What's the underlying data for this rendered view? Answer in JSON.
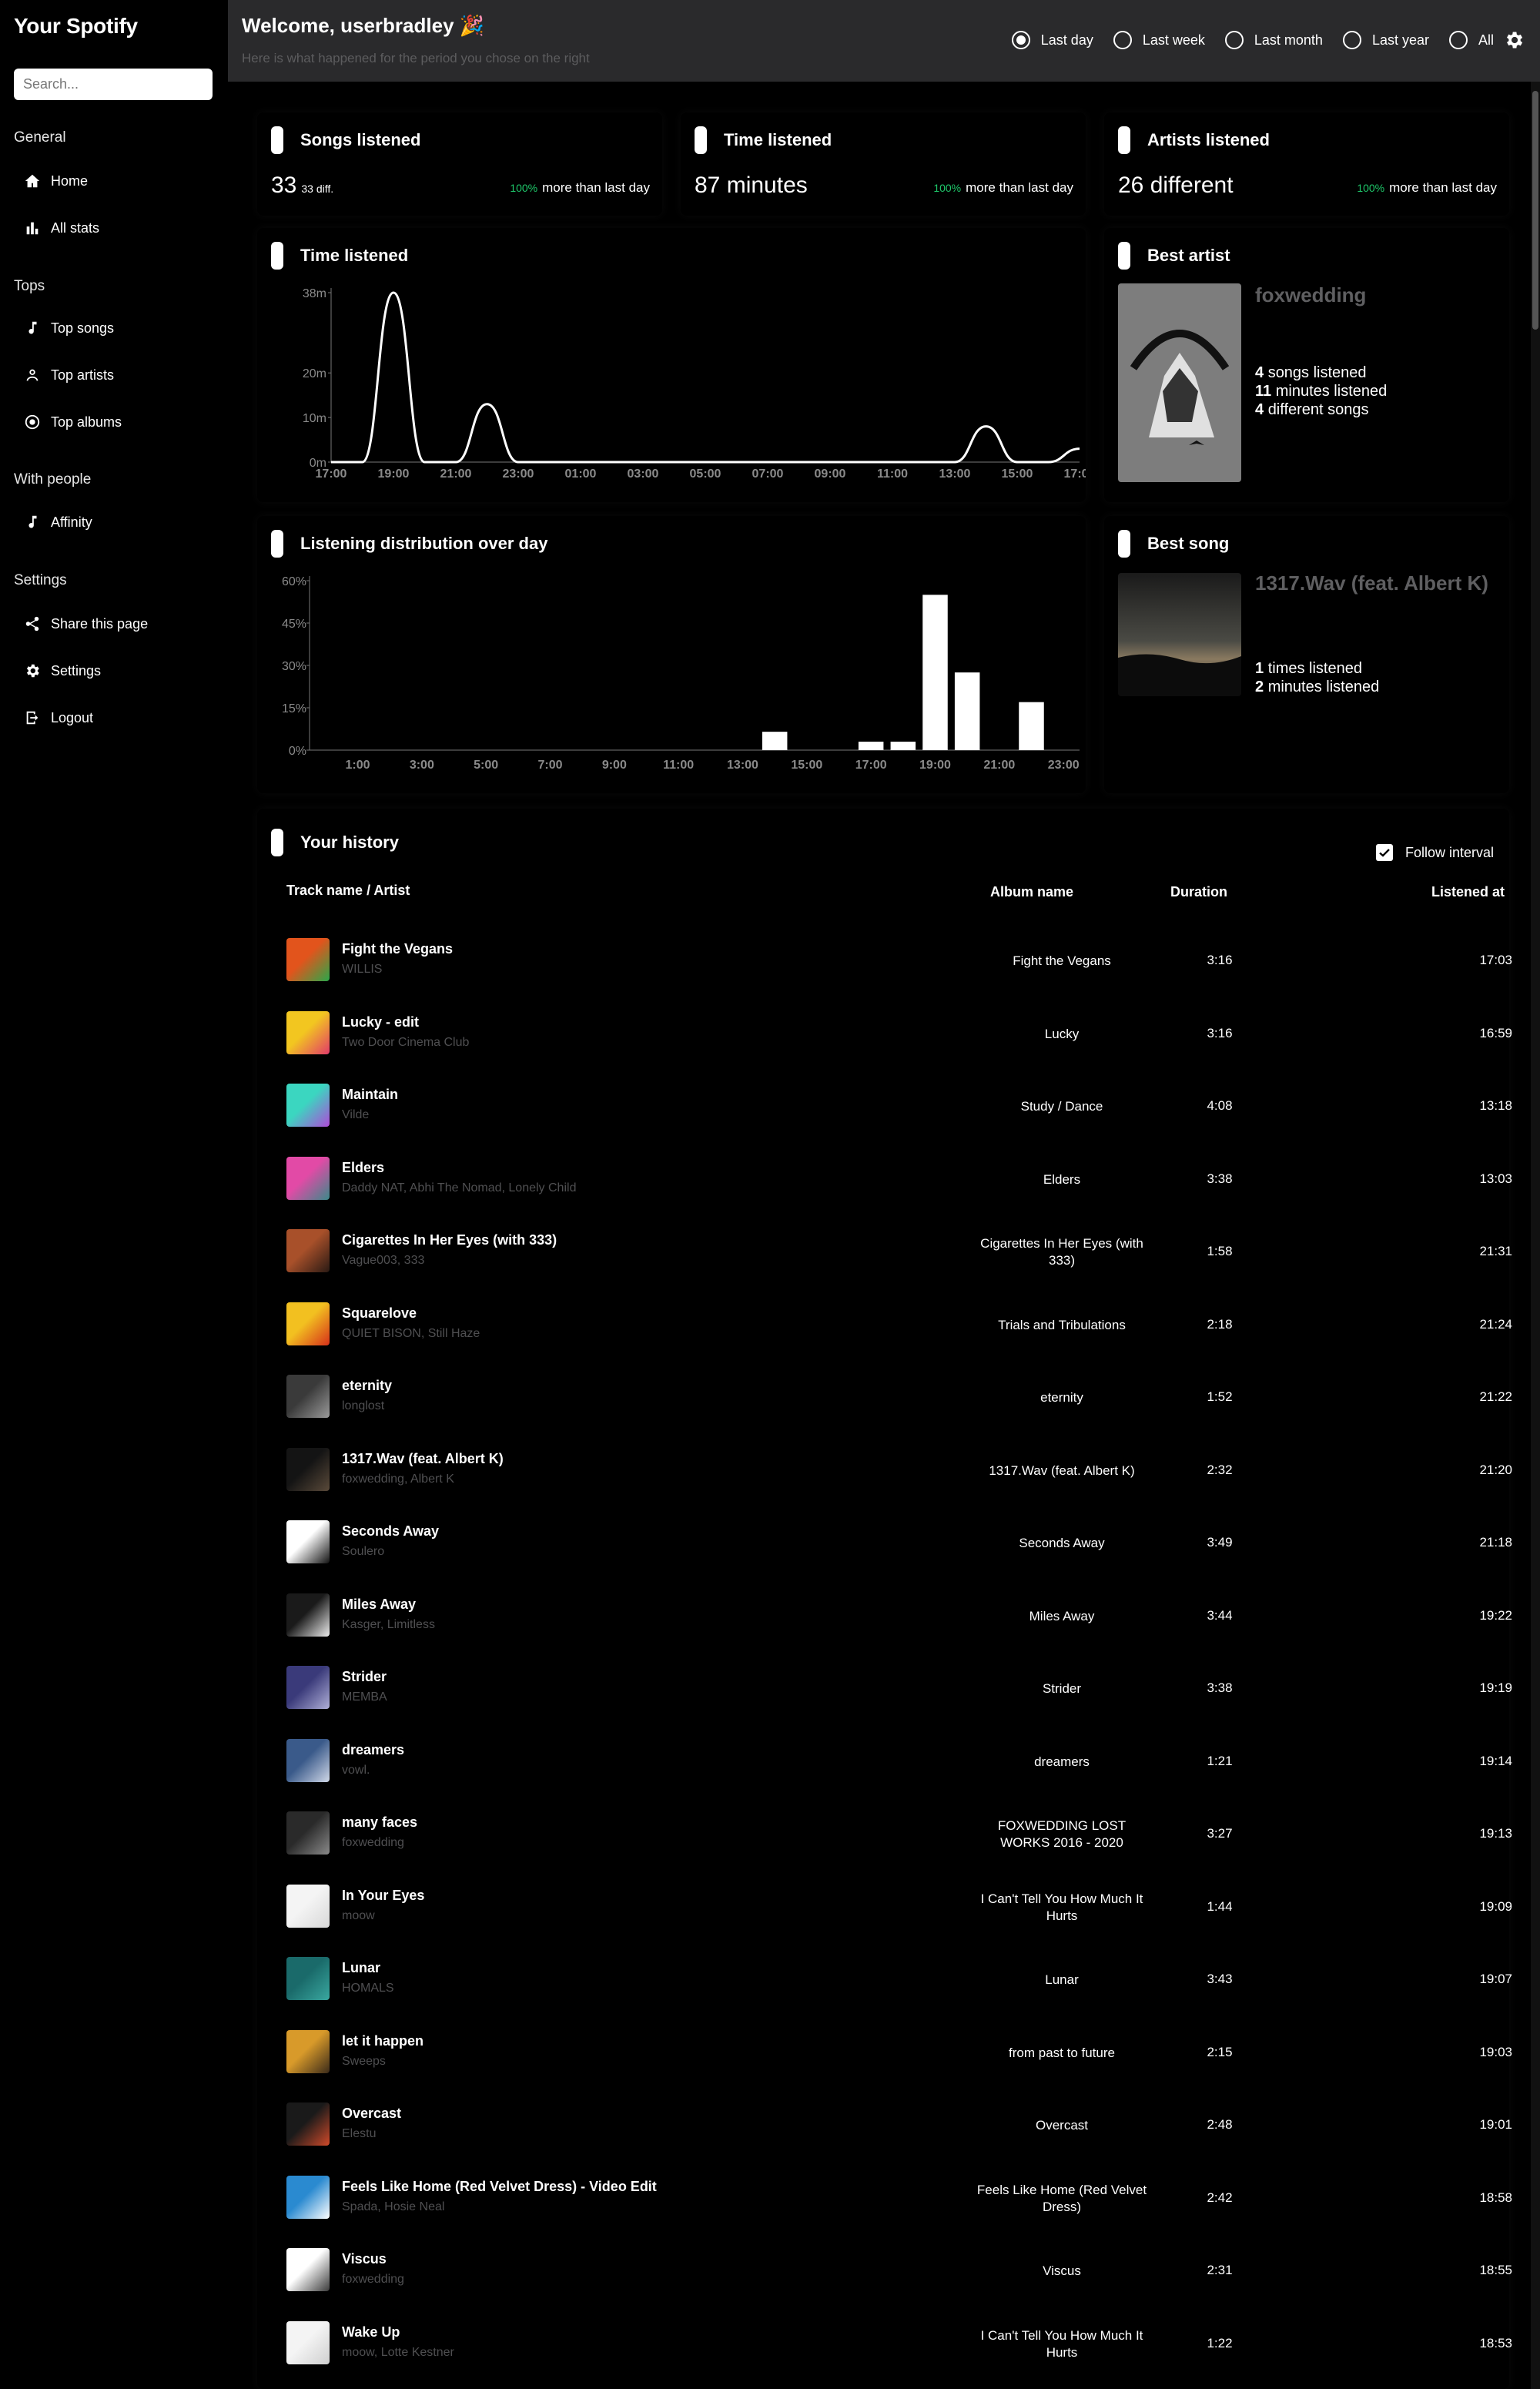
{
  "app": {
    "title": "Your Spotify"
  },
  "search": {
    "placeholder": "Search..."
  },
  "sidebar": {
    "sections": [
      {
        "title": "General",
        "items": [
          {
            "label": "Home",
            "icon": "home-icon"
          },
          {
            "label": "All stats",
            "icon": "bar-chart-icon"
          }
        ]
      },
      {
        "title": "Tops",
        "items": [
          {
            "label": "Top songs",
            "icon": "music-note-icon"
          },
          {
            "label": "Top artists",
            "icon": "person-icon"
          },
          {
            "label": "Top albums",
            "icon": "disc-icon"
          }
        ]
      },
      {
        "title": "With people",
        "items": [
          {
            "label": "Affinity",
            "icon": "music-note-icon"
          }
        ]
      },
      {
        "title": "Settings",
        "items": [
          {
            "label": "Share this page",
            "icon": "share-icon"
          },
          {
            "label": "Settings",
            "icon": "gear-icon"
          },
          {
            "label": "Logout",
            "icon": "logout-icon"
          }
        ]
      }
    ]
  },
  "header": {
    "welcome": "Welcome, userbradley 🎉",
    "subtitle": "Here is what happened for the period you chose on the right",
    "intervals": [
      "Last day",
      "Last week",
      "Last month",
      "Last year",
      "All"
    ],
    "selected_interval": "Last day"
  },
  "stats": {
    "songs": {
      "title": "Songs listened",
      "value": "33",
      "sub": "33 diff.",
      "pct": "100%",
      "delta": "more than last day"
    },
    "time": {
      "title": "Time listened",
      "value": "87 minutes",
      "pct": "100%",
      "delta": "more than last day"
    },
    "artists": {
      "title": "Artists listened",
      "value": "26 different",
      "pct": "100%",
      "delta": "more than last day"
    }
  },
  "time_chart_title": "Time listened",
  "dist_chart_title": "Listening distribution over day",
  "chart_data": [
    {
      "type": "line",
      "title": "Time listened",
      "x": [
        "17:00",
        "18:00",
        "19:00",
        "20:00",
        "21:00",
        "22:00",
        "23:00",
        "00:00",
        "01:00",
        "02:00",
        "03:00",
        "04:00",
        "05:00",
        "06:00",
        "07:00",
        "08:00",
        "09:00",
        "10:00",
        "11:00",
        "12:00",
        "13:00",
        "14:00",
        "15:00",
        "16:00",
        "17:00"
      ],
      "xticks": [
        "17:00",
        "19:00",
        "21:00",
        "23:00",
        "01:00",
        "03:00",
        "05:00",
        "07:00",
        "09:00",
        "11:00",
        "13:00",
        "15:00",
        "17:00"
      ],
      "values": [
        0,
        0,
        38,
        0,
        0,
        13,
        0,
        0,
        0,
        0,
        0,
        0,
        0,
        0,
        0,
        0,
        0,
        0,
        0,
        0,
        0,
        8,
        0,
        0,
        3
      ],
      "yticks": [
        "0m",
        "10m",
        "20m",
        "38m"
      ],
      "ylim": [
        0,
        38
      ]
    },
    {
      "type": "bar",
      "title": "Listening distribution over day",
      "categories": [
        "0:00",
        "1:00",
        "2:00",
        "3:00",
        "4:00",
        "5:00",
        "6:00",
        "7:00",
        "8:00",
        "9:00",
        "10:00",
        "11:00",
        "12:00",
        "13:00",
        "14:00",
        "15:00",
        "16:00",
        "17:00",
        "18:00",
        "19:00",
        "20:00",
        "21:00",
        "22:00",
        "23:00"
      ],
      "xticks": [
        "1:00",
        "3:00",
        "5:00",
        "7:00",
        "9:00",
        "11:00",
        "13:00",
        "15:00",
        "17:00",
        "19:00",
        "21:00",
        "23:00"
      ],
      "values": [
        0,
        0,
        0,
        0,
        0,
        0,
        0,
        0,
        0,
        0,
        0,
        0,
        0,
        0,
        6.5,
        0,
        0,
        3,
        3,
        55,
        27.5,
        0,
        17,
        0
      ],
      "yticks": [
        "0%",
        "15%",
        "30%",
        "45%",
        "60%"
      ],
      "ylim": [
        0,
        60
      ]
    }
  ],
  "best_artist": {
    "title": "Best artist",
    "name": "foxwedding",
    "l1n": "4",
    "l1": "songs listened",
    "l2n": "11",
    "l2": "minutes listened",
    "l3n": "4",
    "l3": "different songs"
  },
  "best_song": {
    "title": "Best song",
    "name": "1317.Wav (feat. Albert K)",
    "l1n": "1",
    "l1": "times listened",
    "l2n": "2",
    "l2": "minutes listened"
  },
  "history": {
    "title": "Your history",
    "follow_label": "Follow interval",
    "columns": {
      "track": "Track name / Artist",
      "album": "Album name",
      "duration": "Duration",
      "at": "Listened at"
    },
    "rows": [
      {
        "name": "Fight the Vegans",
        "artist": "WILLIS",
        "album": "Fight the Vegans",
        "duration": "3:16",
        "at": "17:03",
        "c1": "#e2541c",
        "c2": "#2aa84a"
      },
      {
        "name": "Lucky - edit",
        "artist": "Two Door Cinema Club",
        "album": "Lucky",
        "duration": "3:16",
        "at": "16:59",
        "c1": "#f2c620",
        "c2": "#e23a6a"
      },
      {
        "name": "Maintain",
        "artist": "Vilde",
        "album": "Study / Dance",
        "duration": "4:08",
        "at": "13:18",
        "c1": "#3bd6c0",
        "c2": "#b04ad8"
      },
      {
        "name": "Elders",
        "artist": "Daddy NAT, Abhi The Nomad, Lonely Child",
        "album": "Elders",
        "duration": "3:38",
        "at": "13:03",
        "c1": "#e24aa6",
        "c2": "#3a8a8a"
      },
      {
        "name": "Cigarettes In Her Eyes (with 333)",
        "artist": "Vague003, 333",
        "album": "Cigarettes In Her Eyes (with 333)",
        "duration": "1:58",
        "at": "21:31",
        "c1": "#a8502a",
        "c2": "#2a1a14"
      },
      {
        "name": "Squarelove",
        "artist": "QUIET BISON, Still Haze",
        "album": "Trials and Tribulations",
        "duration": "2:18",
        "at": "21:24",
        "c1": "#f2c020",
        "c2": "#d6301a"
      },
      {
        "name": "eternity",
        "artist": "longlost",
        "album": "eternity",
        "duration": "1:52",
        "at": "21:22",
        "c1": "#3a3a3a",
        "c2": "#9a9a9a"
      },
      {
        "name": "1317.Wav (feat. Albert K)",
        "artist": "foxwedding, Albert K",
        "album": "1317.Wav (feat. Albert K)",
        "duration": "2:32",
        "at": "21:20",
        "c1": "#141414",
        "c2": "#5a4a3a"
      },
      {
        "name": "Seconds Away",
        "artist": "Soulero",
        "album": "Seconds Away",
        "duration": "3:49",
        "at": "21:18",
        "c1": "#ffffff",
        "c2": "#111111"
      },
      {
        "name": "Miles Away",
        "artist": "Kasger, Limitless",
        "album": "Miles Away",
        "duration": "3:44",
        "at": "19:22",
        "c1": "#1a1a1a",
        "c2": "#eeeeee"
      },
      {
        "name": "Strider",
        "artist": "MEMBA",
        "album": "Strider",
        "duration": "3:38",
        "at": "19:19",
        "c1": "#3a3a7a",
        "c2": "#b0b0d8"
      },
      {
        "name": "dreamers",
        "artist": "vowl.",
        "album": "dreamers",
        "duration": "1:21",
        "at": "19:14",
        "c1": "#3a5a8a",
        "c2": "#d0d8e8"
      },
      {
        "name": "many faces",
        "artist": "foxwedding",
        "album": "FOXWEDDING LOST WORKS 2016 - 2020",
        "duration": "3:27",
        "at": "19:13",
        "c1": "#2a2a2a",
        "c2": "#8a8a8a"
      },
      {
        "name": "In Your Eyes",
        "artist": "moow",
        "album": "I Can't Tell You How Much It Hurts",
        "duration": "1:44",
        "at": "19:09",
        "c1": "#f4f4f4",
        "c2": "#d8d8d8"
      },
      {
        "name": "Lunar",
        "artist": "HOMALS",
        "album": "Lunar",
        "duration": "3:43",
        "at": "19:07",
        "c1": "#1a6a6a",
        "c2": "#3aa8a0"
      },
      {
        "name": "let it happen",
        "artist": "Sweeps",
        "album": "from past to future",
        "duration": "2:15",
        "at": "19:03",
        "c1": "#d89a2a",
        "c2": "#3a2a1a"
      },
      {
        "name": "Overcast",
        "artist": "Elestu",
        "album": "Overcast",
        "duration": "2:48",
        "at": "19:01",
        "c1": "#1a1a1a",
        "c2": "#d04a2a"
      },
      {
        "name": "Feels Like Home (Red Velvet Dress) - Video Edit",
        "artist": "Spada, Hosie Neal",
        "album": "Feels Like Home (Red Velvet Dress)",
        "duration": "2:42",
        "at": "18:58",
        "c1": "#2a8ad0",
        "c2": "#ffffff"
      },
      {
        "name": "Viscus",
        "artist": "foxwedding",
        "album": "Viscus",
        "duration": "2:31",
        "at": "18:55",
        "c1": "#ffffff",
        "c2": "#3a3a3a"
      },
      {
        "name": "Wake Up",
        "artist": "moow, Lotte Kestner",
        "album": "I Can't Tell You How Much It Hurts",
        "duration": "1:22",
        "at": "18:53",
        "c1": "#f4f4f4",
        "c2": "#cfcfcf"
      }
    ]
  }
}
